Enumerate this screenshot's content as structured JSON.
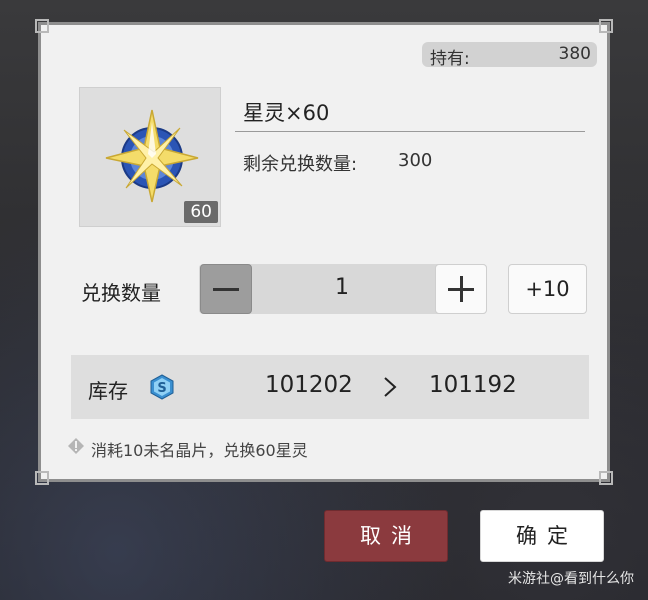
{
  "held": {
    "label": "持有:",
    "value": "380"
  },
  "item": {
    "name": "星灵×60",
    "count_badge": "60",
    "icon": "star-spirit-icon",
    "remaining_label": "剩余兑换数量:",
    "remaining_value": "300"
  },
  "quantity": {
    "label": "兑换数量",
    "value": "1",
    "plus10_label": "+10"
  },
  "stock": {
    "label": "库存",
    "icon": "currency-s-icon",
    "from": "101202",
    "to": "101192"
  },
  "hint": {
    "icon": "info-diamond-icon",
    "text": "消耗10未名晶片，兑换60星灵"
  },
  "buttons": {
    "cancel": "取消",
    "confirm": "确定"
  },
  "colors": {
    "cancel_bg": "#8b3a3e",
    "dialog_bg": "#f1f1f1",
    "stock_icon": "#3a8fd0"
  },
  "bottom_watermark": "米游社@看到什么你"
}
